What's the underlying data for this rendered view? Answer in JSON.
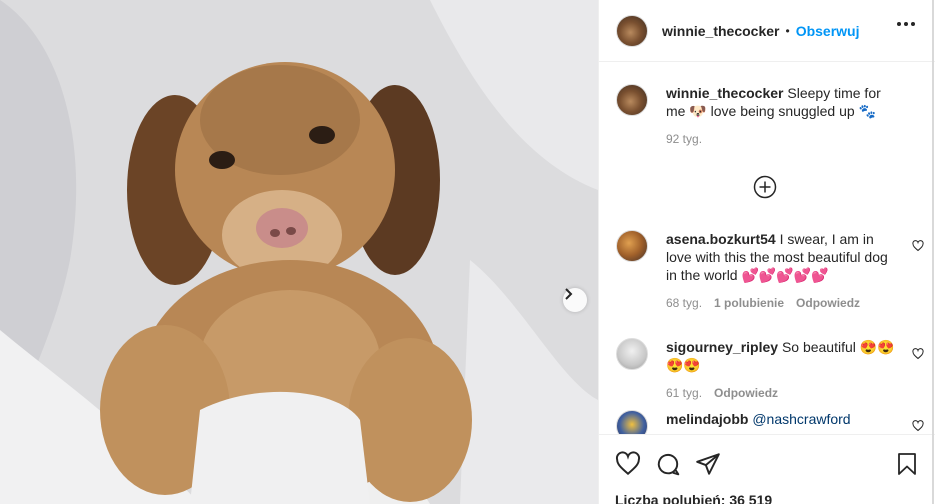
{
  "post": {
    "username": "winnie_thecocker",
    "follow_label": "Obserwuj",
    "separator": "•",
    "caption": "Sleepy time for me 🐶 love being snuggled up 🐾",
    "caption_time": "92 tyg.",
    "likes_label": "Liczba polubień: 36 519"
  },
  "comments": [
    {
      "username": "asena.bozkurt54",
      "text": "I swear, I am in love with this the most beautiful dog in the world 💕💕💕💕💕",
      "time": "68 tyg.",
      "likes": "1 polubienie",
      "reply": "Odpowiedz"
    },
    {
      "username": "sigourney_ripley",
      "text": "So beautiful 😍😍😍😍",
      "time": "61 tyg.",
      "reply": "Odpowiedz"
    },
    {
      "username": "melindajobb",
      "text": "@nashcrawford"
    }
  ],
  "icons": {
    "more": "more-options-icon",
    "load_more": "plus-circle-icon",
    "like": "heart-icon",
    "comment": "comment-bubble-icon",
    "share": "paper-plane-icon",
    "save": "bookmark-icon",
    "next": "chevron-right-icon"
  },
  "colors": {
    "accent": "#0095f6",
    "text": "#262626",
    "muted": "#8e8e8e",
    "mention": "#00376b"
  }
}
